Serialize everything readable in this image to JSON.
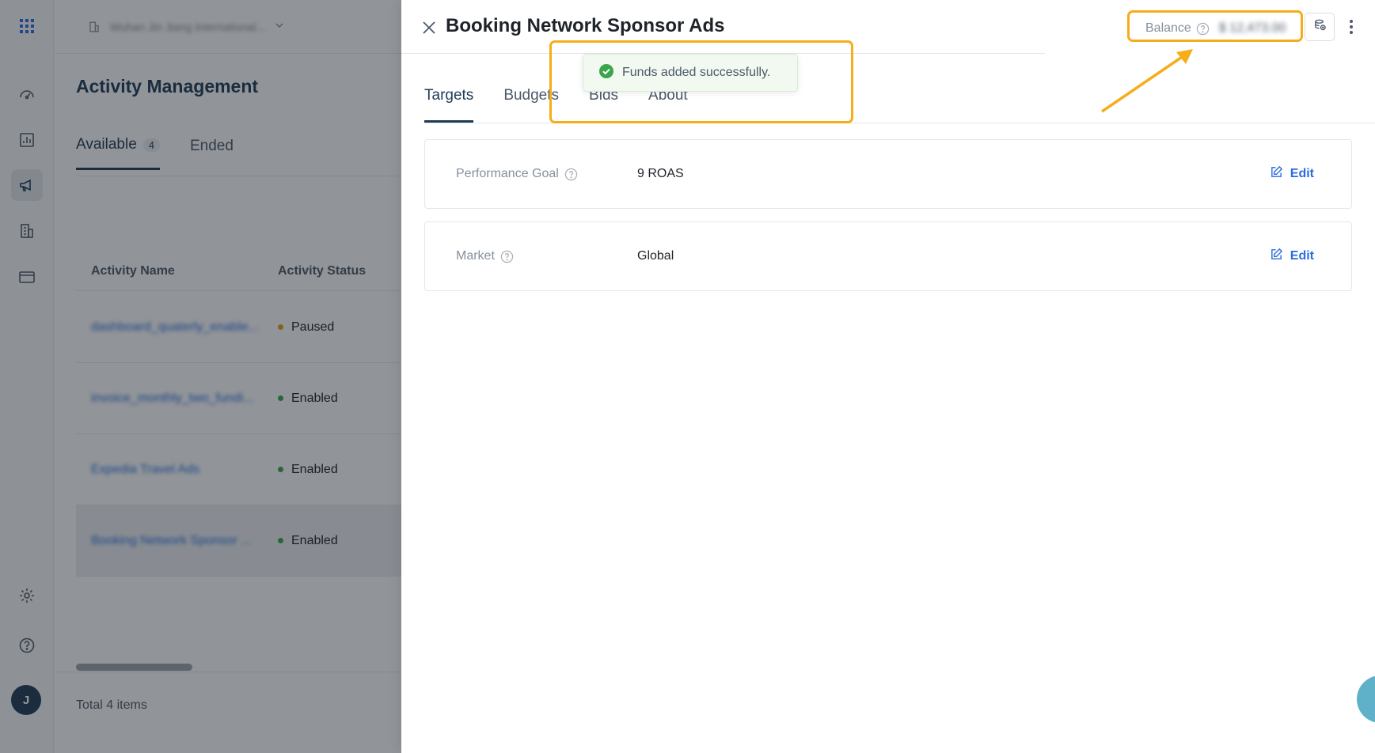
{
  "rail": {
    "items": [
      "grid-icon",
      "dashboard-icon",
      "report-icon",
      "campaign-icon",
      "building-icon",
      "billing-icon",
      "settings-icon",
      "help-icon"
    ],
    "avatar_initial": "J"
  },
  "background": {
    "company": "Wuhan Jin Jiang International...",
    "page_title": "Activity Management",
    "tabs": [
      {
        "label": "Available",
        "count": "4"
      },
      {
        "label": "Ended"
      }
    ],
    "columns": [
      "Activity Name",
      "Activity Status"
    ],
    "rows": [
      {
        "name": "dashboard_quaterly_enable...",
        "status": "Paused",
        "status_color": "#e39a1a"
      },
      {
        "name": "invoice_monthly_two_fundi...",
        "status": "Enabled",
        "status_color": "#3aa54b"
      },
      {
        "name": "Expedia Travel Ads",
        "status": "Enabled",
        "status_color": "#3aa54b"
      },
      {
        "name": "Booking Network Sponsor ...",
        "status": "Enabled",
        "status_color": "#3aa54b"
      }
    ],
    "total": "Total 4 items"
  },
  "drawer": {
    "title": "Booking Network Sponsor Ads",
    "balance_label": "Balance",
    "balance_value": "$ 12,473.00",
    "tabs": [
      "Targets",
      "Budgets",
      "Bids",
      "About"
    ],
    "active_tab": "Targets",
    "cards": [
      {
        "label": "Performance Goal",
        "value": "9 ROAS",
        "action": "Edit"
      },
      {
        "label": "Market",
        "value": "Global",
        "action": "Edit"
      }
    ],
    "toast": "Funds added successfully."
  },
  "colors": {
    "accent": "#1f3b57",
    "link": "#2b6cde",
    "highlight": "#f6ad1a",
    "success": "#3aa54b"
  }
}
